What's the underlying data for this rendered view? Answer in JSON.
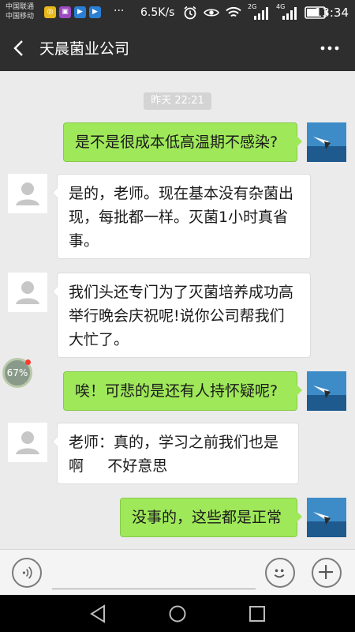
{
  "status_bar": {
    "carrier_1": "中国联通",
    "carrier_2": "中国移动",
    "dots": "···",
    "net_speed": "6.5K/s",
    "signal_1_label": "2G",
    "signal_2_label": "4G",
    "time": "13:34"
  },
  "nav": {
    "title": "天晨菌业公司"
  },
  "chat": {
    "time_separator": "昨天 22:21",
    "messages": [
      {
        "side": "right",
        "text": "是不是很成本低高温期不感染?"
      },
      {
        "side": "left",
        "text": "是的，老师。现在基本没有杂菌出现，每批都一样。灭菌1小时真省事。"
      },
      {
        "side": "left",
        "text": "我们头还专门为了灭菌培养成功高举行晚会庆祝呢!说你公司帮我们大忙了。"
      },
      {
        "side": "right",
        "text": "唉！可悲的是还有人持怀疑呢?"
      },
      {
        "side": "left",
        "text": "老师：真的，学习之前我们也是啊     不好意思"
      },
      {
        "side": "right",
        "text": "没事的，这些都是正常"
      }
    ],
    "float_badge": "67%"
  },
  "input_bar": {
    "placeholder": ""
  },
  "colors": {
    "header_bg": "#2e2e2e",
    "chat_bg": "#ebebeb",
    "sent_bubble": "#9fe85a",
    "received_bubble": "#ffffff"
  },
  "icons": {
    "back": "chevron-left-icon",
    "more": "more-horizontal-icon",
    "voice": "voice-icon",
    "emoji": "emoji-icon",
    "plus": "plus-icon"
  }
}
